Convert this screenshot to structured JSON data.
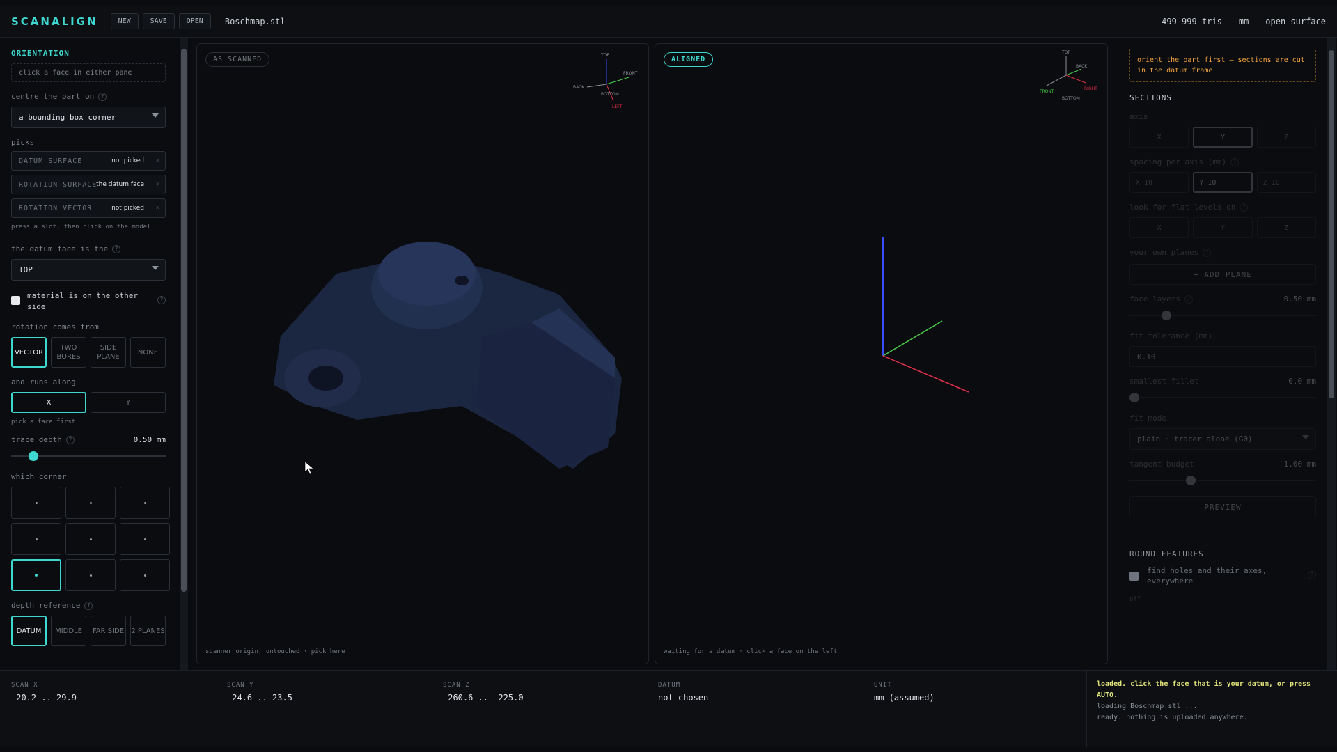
{
  "app": {
    "title": "SCANALIGN",
    "buttons": [
      "NEW",
      "SAVE",
      "OPEN"
    ],
    "file_name": "Boschmap.stl"
  },
  "status": {
    "tris": "499 999 tris",
    "unit": "mm",
    "surface": "open surface"
  },
  "left": {
    "orientation_title": "ORIENTATION",
    "orientation_hint": "click a face in either pane",
    "centre_label": "centre the part on",
    "centre_value": "a bounding box corner",
    "picks_label": "picks",
    "picks": [
      {
        "key": "DATUM SURFACE",
        "value": "not picked"
      },
      {
        "key": "ROTATION SURFACE",
        "value": "the datum face"
      },
      {
        "key": "ROTATION VECTOR",
        "value": "not picked"
      }
    ],
    "picks_hint": "press a slot, then click on the model",
    "datum_face_label": "the datum face is the",
    "datum_face_value": "TOP",
    "material_label": "material is on the other side",
    "rotation_label": "rotation comes from",
    "rotation_options": [
      "VECTOR",
      "TWO BORES",
      "SIDE PLANE",
      "NONE"
    ],
    "rotation_selected": 0,
    "runs_label": "and runs along",
    "runs_options": [
      "X",
      "Y"
    ],
    "runs_selected": 0,
    "runs_hint": "pick a face first",
    "trace_label": "trace depth",
    "trace_value": "0.50 mm",
    "trace_level": 0.12,
    "corner_label": "which corner",
    "corner_selected": 6,
    "depth_label": "depth reference",
    "depth_options": [
      "DATUM",
      "MIDDLE",
      "FAR SIDE",
      "2 PLANES"
    ],
    "depth_selected": 0
  },
  "viewports": {
    "left_label": "AS SCANNED",
    "left_footer": "scanner origin, untouched · pick here",
    "right_label": "ALIGNED",
    "right_footer": "waiting for a datum · click a face on the left",
    "left_gizmo": {
      "top": "TOP",
      "back": "BACK",
      "front": "FRONT",
      "bottom": "BOTTOM",
      "left": "LEFT"
    },
    "right_gizmo": {
      "top": "TOP",
      "back": "BACK",
      "front": "FRONT",
      "bottom": "BOTTOM",
      "right": "RIGHT"
    }
  },
  "right": {
    "warning": "orient the part first — sections are cut in the datum frame",
    "sections_title": "SECTIONS",
    "axis_label": "axis",
    "axis_options": [
      "X",
      "Y",
      "Z"
    ],
    "axis_selected": 1,
    "spacing_label": "spacing per axis (mm)",
    "spacing": [
      {
        "axis": "X",
        "value": "10"
      },
      {
        "axis": "Y",
        "value": "10"
      },
      {
        "axis": "Z",
        "value": "10"
      }
    ],
    "flat_label": "look for flat levels on",
    "flat_options": [
      "X",
      "Y",
      "Z"
    ],
    "planes_label": "your own planes",
    "add_plane": "+ ADD PLANE",
    "face_layers_label": "face layers",
    "face_layers_value": "0.50 mm",
    "face_layers_level": 0.18,
    "fit_tol_label": "fit tolerance (mm)",
    "fit_tol_value": "0.10",
    "fillet_label": "smallest fillet",
    "fillet_value": "0.0 mm",
    "fillet_level": 0.0,
    "fit_mode_label": "fit mode",
    "fit_mode_value": "plain · tracer alone (G0)",
    "tangent_label": "tangent budget",
    "tangent_value": "1.00 mm",
    "tangent_level": 0.32,
    "preview": "PREVIEW",
    "round_title": "ROUND FEATURES",
    "round_text": "find holes and their axes, everywhere",
    "round_tail": "off"
  },
  "bottom": {
    "info": [
      {
        "key": "SCAN X",
        "value": "-20.2 .. 29.9"
      },
      {
        "key": "SCAN Y",
        "value": "-24.6 .. 23.5"
      },
      {
        "key": "SCAN Z",
        "value": "-260.6 .. -225.0"
      },
      {
        "key": "DATUM",
        "value": "not chosen"
      },
      {
        "key": "UNIT",
        "value": "mm (assumed)"
      }
    ],
    "log": [
      "loaded. click the face that is your datum, or press AUTO.",
      "loading Boschmap.stl ...",
      "ready. nothing is uploaded anywhere."
    ]
  },
  "colors": {
    "accent": "#3ed8d0",
    "warning": "#f0a340",
    "log_highlight": "#e0e27a",
    "axis_x": "#e0304a",
    "axis_y": "#4ad04a",
    "axis_z": "#3a4cff",
    "model": "#1e2a48"
  }
}
